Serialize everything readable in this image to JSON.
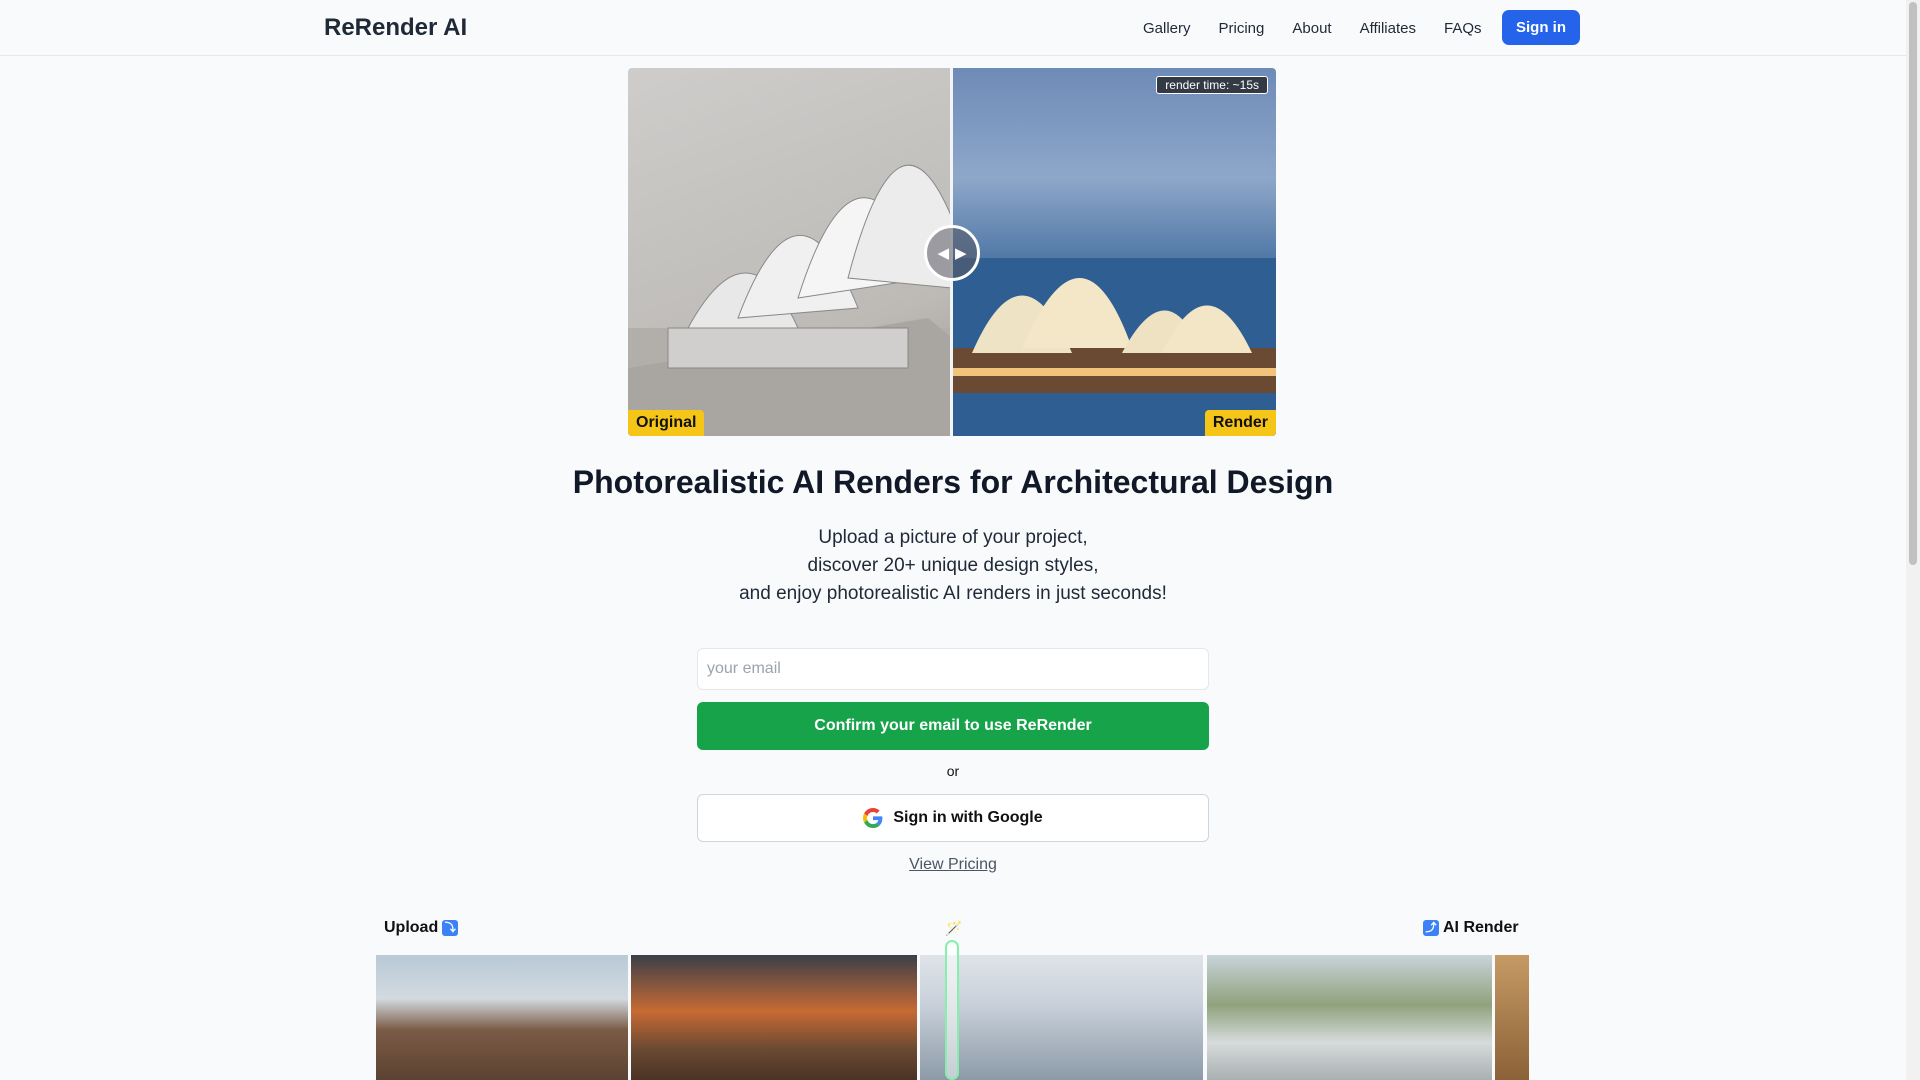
{
  "header": {
    "brand": "ReRender AI",
    "nav": [
      "Gallery",
      "Pricing",
      "About",
      "Affiliates",
      "FAQs"
    ],
    "signin_label": "Sign in"
  },
  "hero_compare": {
    "original_label": "Original",
    "render_label": "Render",
    "render_time": "render time: ~15s"
  },
  "main": {
    "title": "Photorealistic AI Renders for Architectural Design",
    "subtitle_lines": [
      "Upload a picture of your project,",
      "discover 20+ unique design styles,",
      "and enjoy photorealistic AI renders in just seconds!"
    ],
    "email_placeholder": "your email",
    "confirm_label": "Confirm your email to use ReRender",
    "or_label": "or",
    "google_label": "Sign in with Google",
    "view_pricing": "View Pricing"
  },
  "strip": {
    "upload_label": "Upload",
    "upload_icon": "⤵",
    "wand_icon": "🪄",
    "ai_render_icon": "⤴",
    "ai_render_label": "AI Render"
  },
  "colors": {
    "accent_blue": "#2563eb",
    "confirm_green": "#16a34a",
    "tag_yellow": "#f5c518"
  }
}
